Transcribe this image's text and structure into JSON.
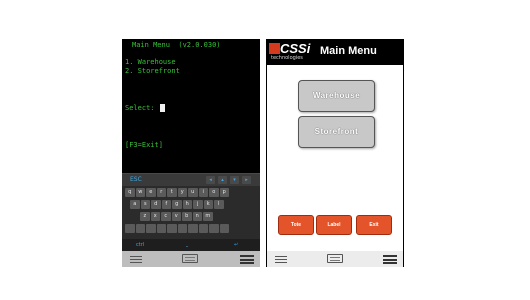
{
  "left": {
    "terminal": {
      "title": "Main Menu  (v2.0.030)",
      "options": [
        "1. Warehouse",
        "2. Storefront"
      ],
      "prompt": "Select:",
      "exit_hint": "[F3=Exit]"
    },
    "keyboard": {
      "esc_label": "ESC",
      "arrows": [
        "◂",
        "▴",
        "▾",
        "▸"
      ],
      "rows": [
        [
          "q",
          "w",
          "e",
          "r",
          "t",
          "y",
          "u",
          "i",
          "o",
          "p"
        ],
        [
          "a",
          "s",
          "d",
          "f",
          "g",
          "h",
          "j",
          "k",
          "l"
        ],
        [
          "z",
          "x",
          "c",
          "v",
          "b",
          "n",
          "m"
        ],
        [
          "",
          "",
          "",
          "",
          "",
          "",
          "",
          "",
          "",
          ""
        ]
      ],
      "bottom": [
        "ctrl",
        "⎵",
        "↵"
      ]
    },
    "accent_color": "#3fa9e6",
    "text_color": "#36c236"
  },
  "right": {
    "header": {
      "brand": "CSSi",
      "brand_sub": "technologies",
      "title": "Main Menu"
    },
    "menu_buttons": [
      "Warehouse",
      "Storefront"
    ],
    "action_buttons": [
      "Tote",
      "Label",
      "Exit"
    ],
    "action_color": "#e4542a"
  },
  "nav_icons": [
    "menu-icon",
    "keyboard-icon",
    "hamburger-icon"
  ]
}
